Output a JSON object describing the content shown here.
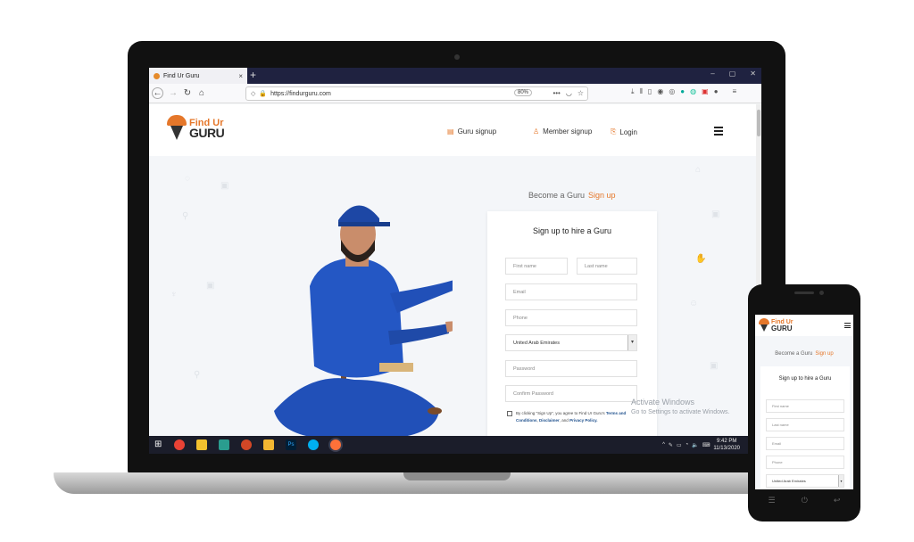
{
  "browser": {
    "tab_title": "Find Ur Guru",
    "tab_close": "×",
    "new_tab": "+",
    "url": "https://findurguru.com",
    "zoom": "80%",
    "window_controls": [
      "–",
      "▢",
      "✕"
    ]
  },
  "site": {
    "logo_line1": "Find Ur",
    "logo_line2": "GURU",
    "nav": [
      {
        "label": "Guru signup",
        "icon": "document-icon"
      },
      {
        "label": "Member signup",
        "icon": "user-icon"
      },
      {
        "label": "Login",
        "icon": "login-icon"
      }
    ]
  },
  "hero": {
    "become_text": "Become a Guru",
    "signup_link": "Sign up"
  },
  "form": {
    "title": "Sign up to hire a Guru",
    "first_name_placeholder": "First name",
    "last_name_placeholder": "Last name",
    "email_placeholder": "Email",
    "phone_placeholder": "Phone",
    "country_selected": "United Arab Emirates",
    "password_placeholder": "Password",
    "confirm_password_placeholder": "Confirm Password",
    "terms_prefix": "By clicking \"Sign Up\", you agree to Find Ur Guru's",
    "terms_link": "Terms and Conditions",
    "disclaimer_link": "Disclaimer",
    "terms_and": "and",
    "privacy_link": "Privacy Policy."
  },
  "watermark": {
    "line1": "Activate Windows",
    "line2": "Go to Settings to activate Windows."
  },
  "taskbar": {
    "time": "9:42 PM",
    "date": "11/13/2020"
  },
  "phone": {
    "become_text": "Become a Guru",
    "signup_link": "Sign up",
    "form_title": "Sign up to hire a Guru",
    "first_name_placeholder": "First name",
    "last_name_placeholder": "Last name",
    "email_placeholder": "Email",
    "phone_placeholder": "Phone",
    "country_selected": "United Arab Emirates"
  },
  "colors": {
    "accent": "#e5772a",
    "worker_blue": "#2150b8",
    "link_blue": "#1d4f8c"
  }
}
